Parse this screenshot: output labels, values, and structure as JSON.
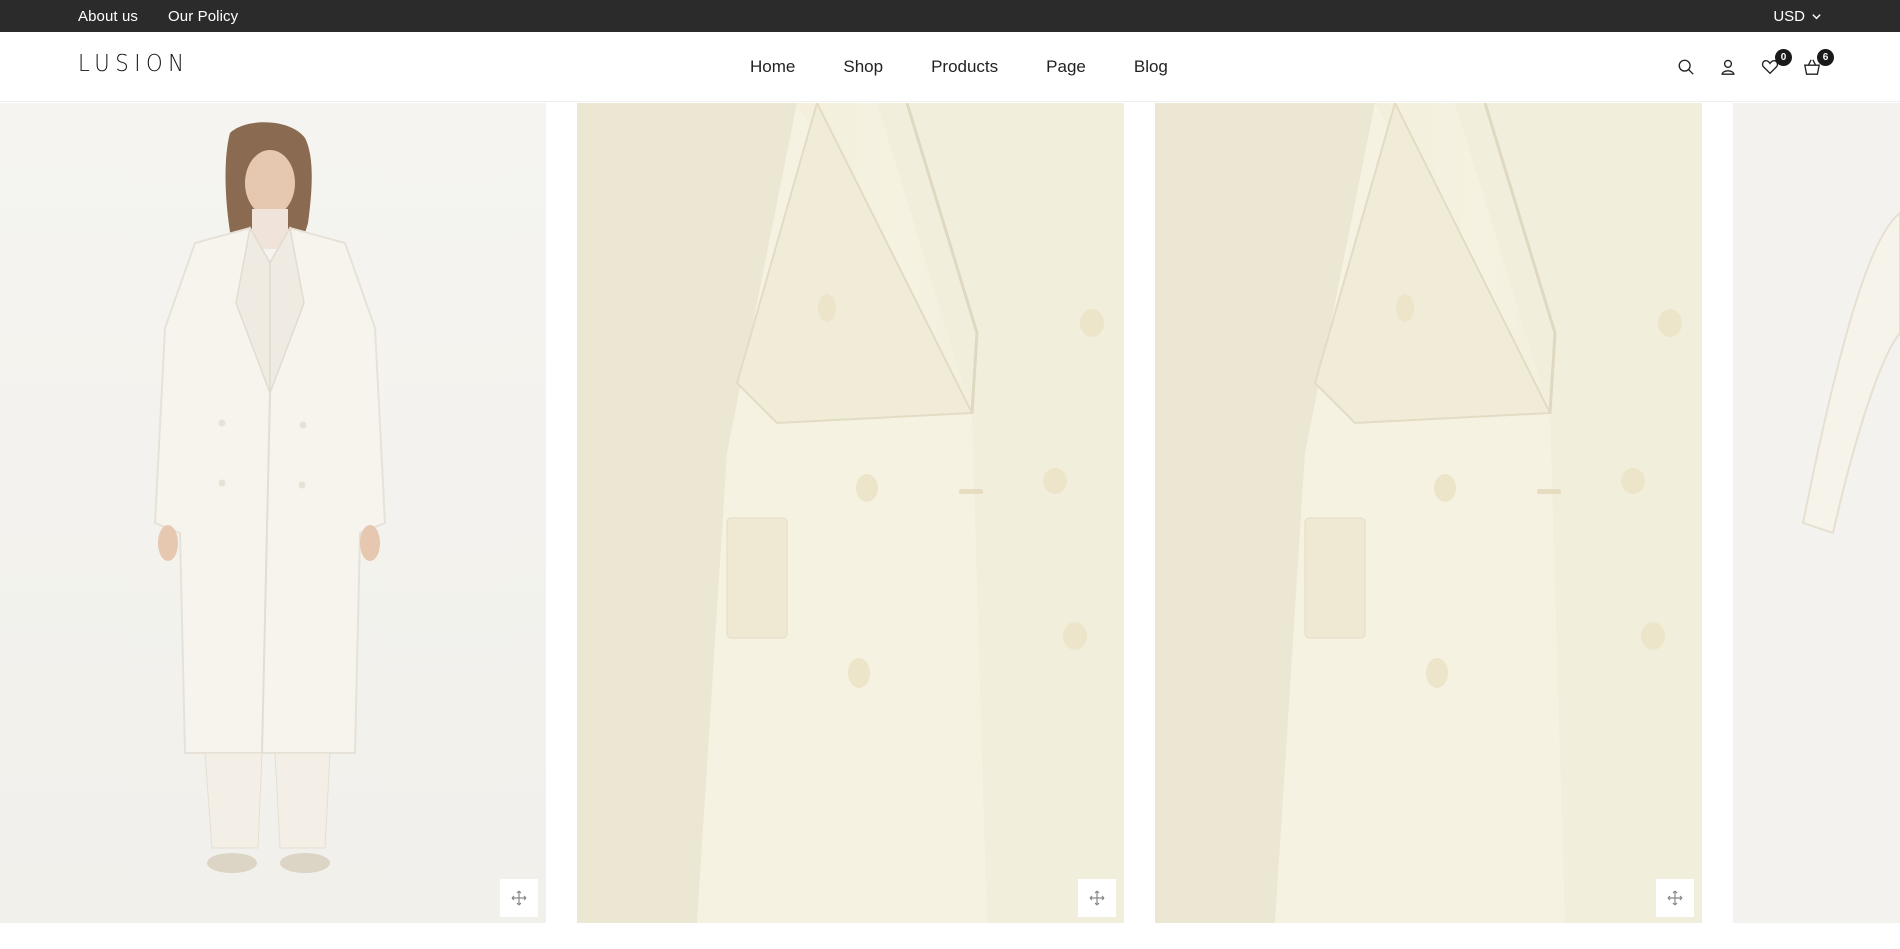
{
  "topbar": {
    "about_label": "About us",
    "policy_label": "Our Policy",
    "currency_label": "USD"
  },
  "header": {
    "logo": "LUSION",
    "nav": [
      "Home",
      "Shop",
      "Products",
      "Page",
      "Blog"
    ],
    "wishlist_count": "0",
    "cart_count": "6"
  },
  "gallery": {
    "slides": [
      {
        "image": "model-full-length-cream-coat"
      },
      {
        "image": "cream-coat-closeup-buttons"
      },
      {
        "image": "cream-coat-closeup-buttons"
      },
      {
        "image": "cream-coat-sleeve-partial"
      }
    ]
  },
  "colors": {
    "topbar_bg": "#2b2b2b",
    "coat_cream": "#f5f1de",
    "badge_bg": "#1a1a1a"
  }
}
